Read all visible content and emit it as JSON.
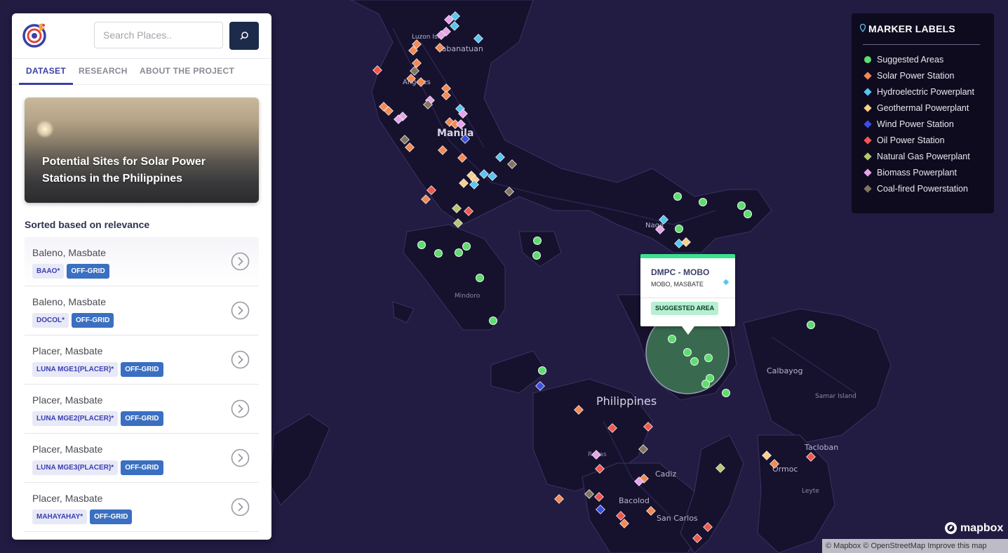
{
  "app": {
    "search": {
      "placeholder": "Search Places.."
    },
    "tabs": [
      {
        "label": "DATASET",
        "active": true
      },
      {
        "label": "RESEARCH",
        "active": false
      },
      {
        "label": "ABOUT THE PROJECT",
        "active": false
      }
    ],
    "hero_title": "Potential Sites for Solar Power Stations in the Philippines",
    "sorted_label": "Sorted based on relevance",
    "sites": [
      {
        "location": "Baleno, Masbate",
        "code": "BAAO*",
        "grid": "OFF-GRID"
      },
      {
        "location": "Baleno, Masbate",
        "code": "DOCOL*",
        "grid": "OFF-GRID"
      },
      {
        "location": "Placer, Masbate",
        "code": "LUNA MGE1(PLACER)*",
        "grid": "OFF-GRID"
      },
      {
        "location": "Placer, Masbate",
        "code": "LUNA MGE2(PLACER)*",
        "grid": "OFF-GRID"
      },
      {
        "location": "Placer, Masbate",
        "code": "LUNA MGE3(PLACER)*",
        "grid": "OFF-GRID"
      },
      {
        "location": "Placer, Masbate",
        "code": "MAHAYAHAY*",
        "grid": "OFF-GRID"
      }
    ]
  },
  "legend": {
    "title": "MARKER LABELS",
    "items": [
      {
        "label": "Suggested Areas",
        "shape": "circle",
        "color": "#5fdc6e"
      },
      {
        "label": "Solar Power Station",
        "shape": "diamond",
        "color": "#f48a52"
      },
      {
        "label": "Hydroelectric Powerplant",
        "shape": "diamond",
        "color": "#56c6f2"
      },
      {
        "label": "Geothermal Powerplant",
        "shape": "diamond",
        "color": "#f7d08a"
      },
      {
        "label": "Wind Power Station",
        "shape": "diamond",
        "color": "#3b4fe0"
      },
      {
        "label": "Oil Power Station",
        "shape": "diamond",
        "color": "#f0584d"
      },
      {
        "label": "Natural Gas Powerplant",
        "shape": "diamond",
        "color": "#b3c96d"
      },
      {
        "label": "Biomass Powerplant",
        "shape": "diamond",
        "color": "#e7a4ea"
      },
      {
        "label": "Coal-fired Powerstation",
        "shape": "diamond",
        "color": "#827560"
      }
    ]
  },
  "popup": {
    "title": "DMPC - MOBO",
    "subtitle": "MOBO, MASBATE",
    "badge": "SUGGESTED AREA",
    "accent": "#3be08f"
  },
  "map": {
    "place_labels": [
      "Luzon Isla",
      "Cabanatuan",
      "Angeles",
      "Manila",
      "Naga",
      "Mindoro",
      "Philippines",
      "Calbayog",
      "Samar Island",
      "Tacloban",
      "Ormoc",
      "Leyte",
      "Roxas",
      "Cadiz",
      "Bacolod",
      "San Carlos"
    ],
    "attribution": "© Mapbox © OpenStreetMap Improve this map",
    "logo_text": "mapbox"
  }
}
